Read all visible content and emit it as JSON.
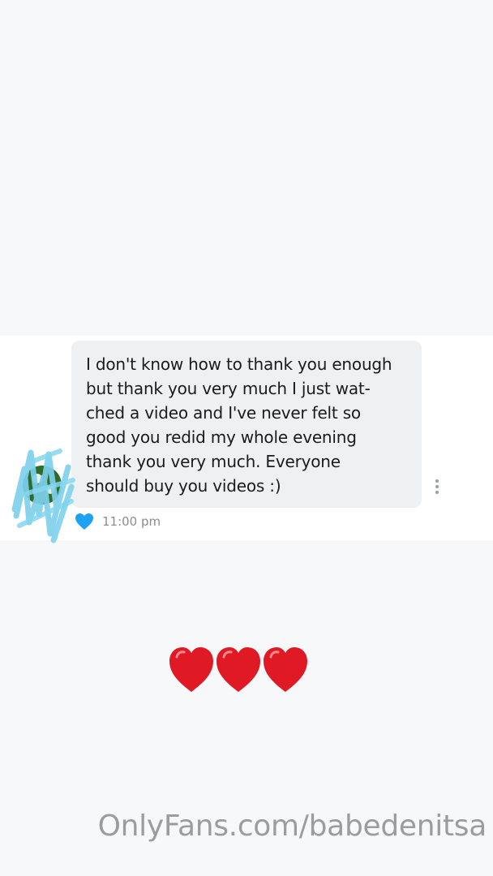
{
  "message": {
    "text": "I don't know how to thank you enough\nbut thank you very much I just wat-\nched a video and I've never felt so\ngood you redid my whole evening\nthank you very much. Everyone\nshould buy you videos :)",
    "timestamp": "11:00 pm",
    "like_color": "#1da1f2",
    "avatar": "avatar-redacted-scribble",
    "more_icon": "more-vertical-icon"
  },
  "decoration": {
    "hearts": [
      "❤️",
      "❤️",
      "❤️"
    ],
    "heart_color": "#e01a24"
  },
  "watermark": "OnlyFans.com/babedenitsa",
  "colors": {
    "bubble": "#eef0f2",
    "background": "#f7f8fa",
    "scribble": "#7fd0ec"
  }
}
